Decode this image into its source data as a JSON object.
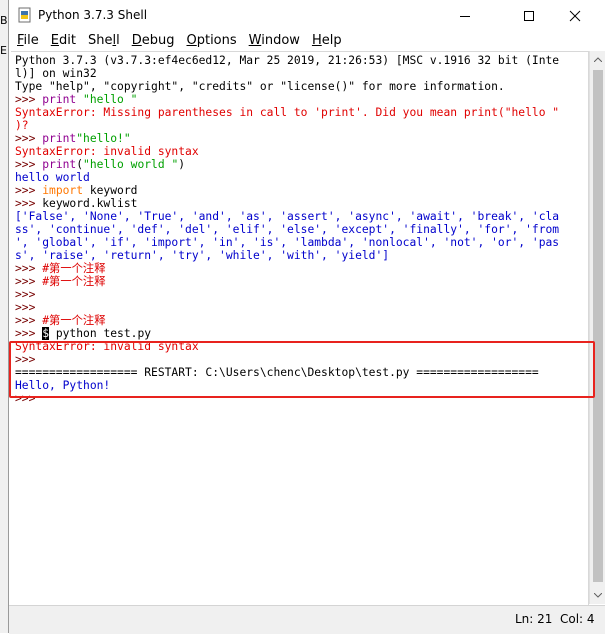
{
  "edge": {
    "letters": [
      "B",
      "E"
    ]
  },
  "window": {
    "title": "Python 3.7.3 Shell",
    "icon": "python-idle-icon",
    "controls": [
      "minimize-icon",
      "maximize-icon",
      "close-icon"
    ]
  },
  "menu": [
    {
      "accel": "F",
      "rest": "ile"
    },
    {
      "accel": "E",
      "rest": "dit"
    },
    {
      "pre": "She",
      "accel": "l",
      "rest": "l"
    },
    {
      "accel": "D",
      "rest": "ebug"
    },
    {
      "accel": "O",
      "rest": "ptions"
    },
    {
      "accel": "W",
      "rest": "indow"
    },
    {
      "accel": "H",
      "rest": "elp"
    }
  ],
  "shell": {
    "lines": [
      [
        {
          "t": "Python 3.7.3 (v3.7.3:ef4ec6ed12, Mar 25 2019, 21:26:53) [MSC v.1916 32 bit (Inte",
          "c": "code"
        }
      ],
      [
        {
          "t": "l)] on win32",
          "c": "code"
        }
      ],
      [
        {
          "t": "Type \"help\", \"copyright\", \"credits\" or \"license()\" for more information.",
          "c": "code"
        }
      ],
      [
        {
          "t": ">>> ",
          "c": "prompt"
        },
        {
          "t": "print",
          "c": "builtin"
        },
        {
          "t": " ",
          "c": "code"
        },
        {
          "t": "\"hello \"",
          "c": "string"
        }
      ],
      [
        {
          "t": "SyntaxError: Missing parentheses in call to 'print'. Did you mean print(\"hello \"",
          "c": "error"
        }
      ],
      [
        {
          "t": ")?",
          "c": "error"
        }
      ],
      [
        {
          "t": ">>> ",
          "c": "prompt"
        },
        {
          "t": "print",
          "c": "builtin"
        },
        {
          "t": "\"hello!\"",
          "c": "string"
        }
      ],
      [
        {
          "t": "SyntaxError: invalid syntax",
          "c": "error"
        }
      ],
      [
        {
          "t": ">>> ",
          "c": "prompt"
        },
        {
          "t": "print",
          "c": "builtin"
        },
        {
          "t": "(",
          "c": "code"
        },
        {
          "t": "\"hello world \"",
          "c": "string"
        },
        {
          "t": ")",
          "c": "code"
        }
      ],
      [
        {
          "t": "hello world",
          "c": "output"
        }
      ],
      [
        {
          "t": ">>> ",
          "c": "prompt"
        },
        {
          "t": "import",
          "c": "keyword"
        },
        {
          "t": " keyword",
          "c": "code"
        }
      ],
      [
        {
          "t": ">>> ",
          "c": "prompt"
        },
        {
          "t": "keyword.kwlist",
          "c": "code"
        }
      ],
      [
        {
          "t": "['False', 'None', 'True', 'and', 'as', 'assert', 'async', 'await', 'break', 'cla",
          "c": "output"
        }
      ],
      [
        {
          "t": "ss', 'continue', 'def', 'del', 'elif', 'else', 'except', 'finally', 'for', 'from",
          "c": "output"
        }
      ],
      [
        {
          "t": "', 'global', 'if', 'import', 'in', 'is', 'lambda', 'nonlocal', 'not', 'or', 'pas",
          "c": "output"
        }
      ],
      [
        {
          "t": "s', 'raise', 'return', 'try', 'while', 'with', 'yield']",
          "c": "output"
        }
      ],
      [
        {
          "t": ">>> ",
          "c": "prompt"
        },
        {
          "t": "#第一个注释",
          "c": "comment"
        }
      ],
      [
        {
          "t": ">>> ",
          "c": "prompt"
        },
        {
          "t": "#第一个注释",
          "c": "comment"
        }
      ],
      [
        {
          "t": ">>> ",
          "c": "prompt"
        }
      ],
      [
        {
          "t": ">>> ",
          "c": "prompt"
        }
      ],
      [
        {
          "t": ">>> ",
          "c": "prompt"
        },
        {
          "t": "#第一个注释",
          "c": "comment"
        }
      ],
      [
        {
          "t": ">>> ",
          "c": "prompt"
        },
        {
          "t": "$",
          "c": "cursor"
        },
        {
          "t": " python test.py",
          "c": "code"
        }
      ],
      [
        {
          "t": "SyntaxError: invalid syntax",
          "c": "error"
        }
      ],
      [
        {
          "t": ">>> ",
          "c": "prompt"
        }
      ],
      [
        {
          "t": "================== RESTART: C:\\Users\\chenc\\Desktop\\test.py ==================",
          "c": "code"
        }
      ],
      [
        {
          "t": "Hello, Python!",
          "c": "output"
        }
      ],
      [
        {
          "t": ">>> ",
          "c": "prompt"
        }
      ]
    ]
  },
  "status": {
    "line": "Ln: 21",
    "col": "Col: 4"
  },
  "colors": {
    "prompt": "#770000",
    "error": "#e00000",
    "string": "#00a000",
    "keyword": "#ff7700",
    "builtin": "#900090",
    "output": "#0000cc",
    "highlight_border": "#e8231e"
  }
}
